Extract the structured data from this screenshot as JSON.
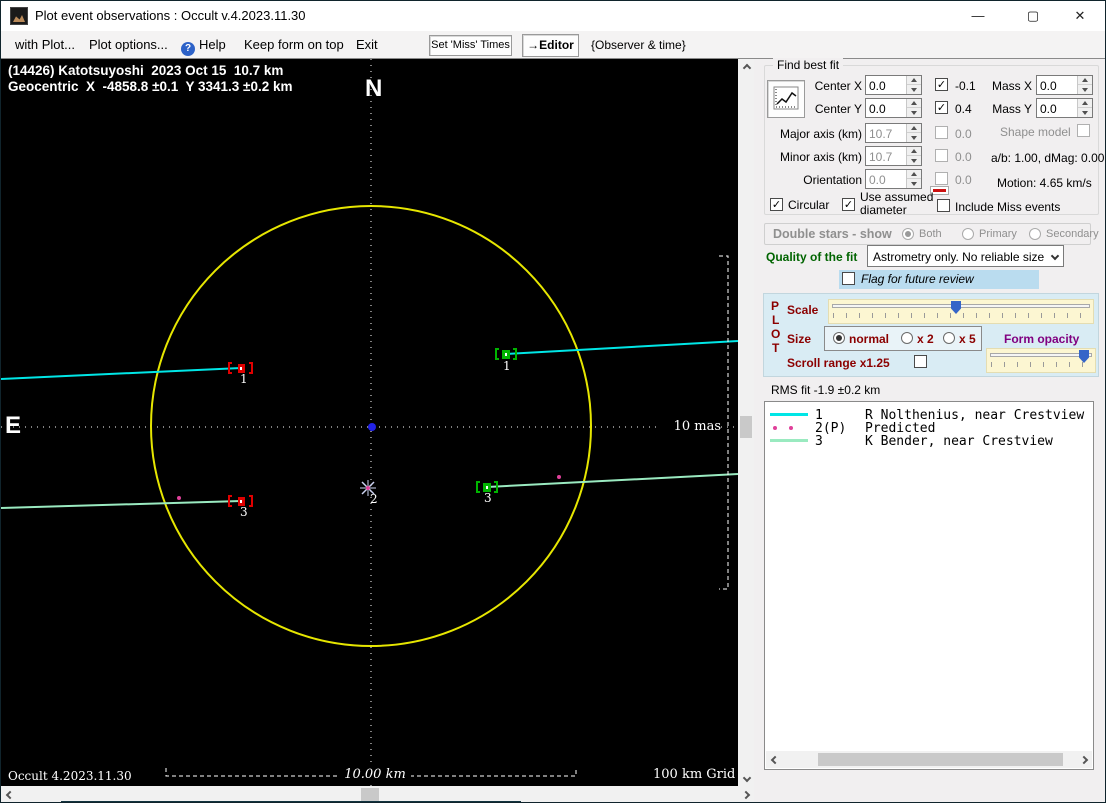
{
  "window": {
    "title": "Plot event observations : Occult v.4.2023.11.30"
  },
  "icons": {
    "app": "occult-logo",
    "help": "?",
    "minimize": "—",
    "maximize": "▢",
    "close": "✕"
  },
  "menu": {
    "with_plot": "with Plot...",
    "plot_options": "Plot options...",
    "help": "Help",
    "keep_on_top": "Keep form on top",
    "exit": "Exit",
    "set_miss_times": "Set 'Miss' Times",
    "editor": "→Editor",
    "observer_time": "{Observer & time}"
  },
  "plot": {
    "header_line1": "(14426) Katotsuyoshi  2023 Oct 15  10.7 km",
    "header_line2": "Geocentric  X  -4858.8 ±0.1  Y 3341.3 ±0.2 km",
    "north_label": "N",
    "east_label": "E",
    "mas_label": "10 mas",
    "scale_label": "10.00 km",
    "grid_label": "100 km Grid",
    "version_label": "Occult 4.2023.11.30",
    "marker_labels": {
      "m1": "1",
      "m2": "2",
      "m3": "3"
    }
  },
  "chart_data": {
    "type": "scatter",
    "title": "(14426) Katotsuyoshi 2023 Oct 15 occultation chord fit",
    "body_diameter_km": 10.7,
    "geocentric_x_km": "-4858.8 ±0.1",
    "geocentric_y_km": "3341.3 ±0.2",
    "rms_fit_km": "-1.9 ±0.2",
    "scale_bar": "10.00 km",
    "angular_scale_bar": "10 mas",
    "grid": "100 km Grid",
    "chords": [
      {
        "id": "1",
        "observer": "R Nolthenius, near Crestview",
        "type": "observed",
        "color": "#00e6e6"
      },
      {
        "id": "2(P)",
        "observer": "Predicted",
        "type": "predicted",
        "color": "#e0409a"
      },
      {
        "id": "3",
        "observer": "K Bender, near Crestview",
        "type": "observed",
        "color": "#9aeac0"
      }
    ]
  },
  "fit": {
    "group_title": "Find best fit",
    "center_x_label": "Center X",
    "center_x": "0.0",
    "center_y_label": "Center Y",
    "center_y": "0.0",
    "cx_offset": "-0.1",
    "cy_offset": "0.4",
    "mass_x_label": "Mass X",
    "mass_x": "0.0",
    "mass_y_label": "Mass Y",
    "mass_y": "0.0",
    "major_label": "Major axis (km)",
    "major": "10.7",
    "major_offset": "0.0",
    "minor_label": "Minor axis (km)",
    "minor": "10.7",
    "minor_offset": "0.0",
    "orient_label": "Orientation",
    "orient": "0.0",
    "orient_offset": "0.0",
    "shape_model": "Shape model",
    "ab_dmag": "a/b: 1.00, dMag: 0.00",
    "motion": "Motion: 4.65 km/s",
    "circular": "Circular",
    "assumed_line1": "Use assumed",
    "assumed_line2": "diameter",
    "include_miss": "Include Miss events"
  },
  "double_stars": {
    "title": "Double stars - show",
    "both": "Both",
    "primary": "Primary",
    "secondary": "Secondary"
  },
  "quality": {
    "label": "Quality of the fit",
    "value": "Astrometry only. No reliable size",
    "flag": "Flag for future review"
  },
  "plot_controls": {
    "p": "P",
    "l": "L",
    "o": "O",
    "t": "T",
    "scale": "Scale",
    "size": "Size",
    "normal": "normal",
    "x2": "x 2",
    "x5": "x 5",
    "form_opacity": "Form opacity",
    "scroll_range": "Scroll range x1.25"
  },
  "rms": "RMS fit -1.9 ±0.2 km",
  "legend": {
    "rows": [
      {
        "id": "1",
        "name": "R Nolthenius, near Crestview"
      },
      {
        "id": "2(P)",
        "name": "Predicted"
      },
      {
        "id": "3",
        "name": "K Bender, near Crestview"
      }
    ]
  },
  "colors": {
    "chord1": "#00e6e6",
    "chord3": "#9aeac0",
    "predicted": "#e0409a",
    "circle": "#e6e600",
    "marker_start": "#e00000",
    "marker_end": "#00b400",
    "center_dot": "#2222e6",
    "quality_label": "#006400",
    "plot_label": "#8b0000",
    "opacity_label": "#800080"
  }
}
